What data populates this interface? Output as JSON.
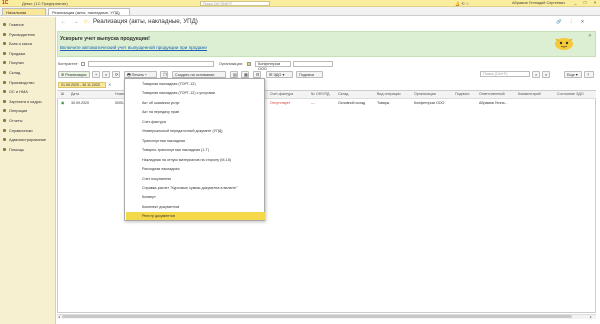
{
  "app": {
    "logo": "1С",
    "title": "Демо: (1С:Предприятие)",
    "search_placeholder": "Поиск Ctrl+Shift+F",
    "user": "Абрамов Геннадий Сергеевич",
    "window_controls": "_ □ ×"
  },
  "tabs": {
    "home": "Начальная страница",
    "doc": "Реализация (акты, накладные, УПД)"
  },
  "sidebar": {
    "items": [
      "Главное",
      "Руководителю",
      "Банк и касса",
      "Продажи",
      "Покупки",
      "Склад",
      "Производство",
      "ОС и НМА",
      "Зарплата и кадры",
      "Операции",
      "Отчеты",
      "Справочники",
      "Администрирование",
      "Помощь"
    ]
  },
  "header": {
    "title": "Реализация (акты, накладные, УПД)",
    "nav": "← →",
    "star": "☆",
    "icons": "🔗 ⋮ ✕"
  },
  "banner": {
    "title": "Ускорьте учет выпуска продукции!",
    "link": "Включите автоматический учет выпущенной продукции при продаже"
  },
  "filters": {
    "counterparty_label": "Контрагент:",
    "organization_label": "Организация:",
    "organization_value": "Конфетпром ООО",
    "edo_label": "ЭДО:",
    "search_placeholder": "Поиск (Ctrl+F)",
    "more": "Еще"
  },
  "toolbar": {
    "create": "Реализация",
    "print": "Печать",
    "create_based_on": "Создать на основании",
    "edo": "ЭДО",
    "signatures": "Подписи",
    "period": "01.09.2020 - 30.11.2020"
  },
  "table": {
    "columns": [
      "Дата",
      "Номер",
      "Счет-фактура",
      "№ СФ/УПД",
      "Склад",
      "Вид операции",
      "Организация",
      "Подписи",
      "Ответственный",
      "Комментарий",
      "Состояние ЭДО"
    ],
    "rows": [
      {
        "date": "30.09.2020",
        "number": "0000-",
        "invoice": "Отсутствует",
        "upd": "—",
        "warehouse": "Основной склад",
        "operation": "Товары",
        "organization": "Конфетпром ООО",
        "signatures": "",
        "responsible": "Абрамов Генна...",
        "comment": "",
        "edo": ""
      }
    ]
  },
  "print_menu": {
    "items": [
      "Товарная накладная (ТОРГ-12)",
      "Товарная накладная (ТОРГ-12) с услугами",
      "Акт об оказании услуг",
      "Акт на передачу прав",
      "Счет-фактура",
      "Универсальный передаточный документ (УПД)",
      "Транспортная накладная",
      "Товарно-транспортная накладная (1-Т)",
      "Накладная на отпуск материалов на сторону (М-15)",
      "Расходная накладная",
      "Счет покупателю",
      "Справка-расчет \"Курсовые суммы документа в валюте\"",
      "Конверт",
      "Комплект документов",
      "Реестр документов"
    ],
    "selected_index": 14
  },
  "colors": {
    "accent": "#f5d84a",
    "banner": "#dcefd3",
    "link": "#1a5fb4",
    "sidebar": "#f6efd0"
  }
}
